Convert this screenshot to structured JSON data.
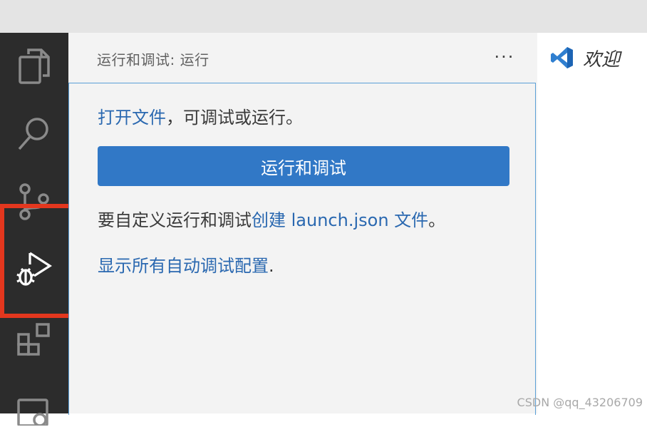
{
  "sidebar": {
    "title": "运行和调试: 运行",
    "more_actions": "···"
  },
  "panel": {
    "open_file_link": "打开文件",
    "open_file_text": "，可调试或运行。",
    "run_button": "运行和调试",
    "custom_prefix": "要自定义运行和调试",
    "create_launch_link": "创建 launch.json 文件",
    "custom_suffix": "。",
    "show_all_link": "显示所有自动调试配置",
    "show_all_suffix": "."
  },
  "editor": {
    "tab_label": "欢迎"
  },
  "activity_bar": {
    "icons": [
      "explorer-icon",
      "search-icon",
      "source-control-icon",
      "run-debug-icon",
      "extensions-icon",
      "remote-explorer-icon"
    ],
    "active": "run-debug-icon"
  },
  "colors": {
    "accent": "#3178c6",
    "link": "#2a68b0",
    "highlight": "#e3371e"
  },
  "watermark": "CSDN @qq_43206709"
}
